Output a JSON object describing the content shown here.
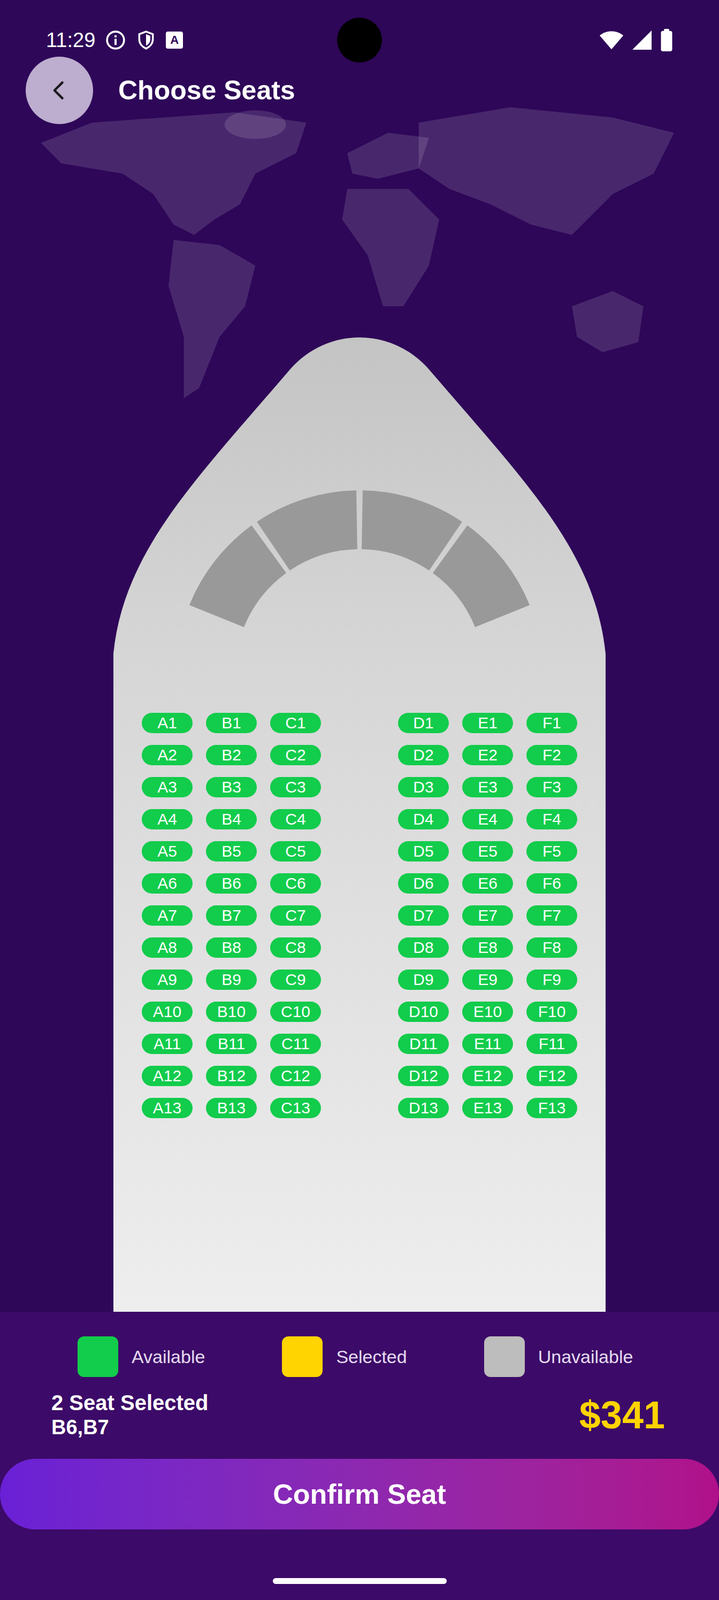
{
  "status_bar": {
    "time": "11:29",
    "keyboard_icon": "A"
  },
  "header": {
    "title": "Choose Seats"
  },
  "seat_rows": [
    {
      "left": [
        {
          "label": "A1",
          "selected": false,
          "available": true
        },
        {
          "label": "B1",
          "selected": false,
          "available": true
        },
        {
          "label": "C1",
          "selected": false,
          "available": true
        }
      ],
      "right": [
        {
          "label": "D1",
          "selected": false,
          "available": true
        },
        {
          "label": "E1",
          "selected": false,
          "available": true
        },
        {
          "label": "F1",
          "selected": false,
          "available": true
        }
      ]
    },
    {
      "left": [
        {
          "label": "A2",
          "selected": false,
          "available": true
        },
        {
          "label": "B2",
          "selected": false,
          "available": true
        },
        {
          "label": "C2",
          "selected": false,
          "available": true
        }
      ],
      "right": [
        {
          "label": "D2",
          "selected": false,
          "available": true
        },
        {
          "label": "E2",
          "selected": false,
          "available": true
        },
        {
          "label": "F2",
          "selected": false,
          "available": true
        }
      ]
    },
    {
      "left": [
        {
          "label": "A3",
          "selected": false,
          "available": true
        },
        {
          "label": "B3",
          "selected": false,
          "available": true
        },
        {
          "label": "C3",
          "selected": false,
          "available": true
        }
      ],
      "right": [
        {
          "label": "D3",
          "selected": false,
          "available": true
        },
        {
          "label": "E3",
          "selected": false,
          "available": true
        },
        {
          "label": "F3",
          "selected": false,
          "available": true
        }
      ]
    },
    {
      "left": [
        {
          "label": "A4",
          "selected": false,
          "available": true
        },
        {
          "label": "B4",
          "selected": false,
          "available": true
        },
        {
          "label": "C4",
          "selected": false,
          "available": true
        }
      ],
      "right": [
        {
          "label": "D4",
          "selected": false,
          "available": true
        },
        {
          "label": "E4",
          "selected": false,
          "available": true
        },
        {
          "label": "F4",
          "selected": false,
          "available": true
        }
      ]
    },
    {
      "left": [
        {
          "label": "A5",
          "selected": false,
          "available": true
        },
        {
          "label": "B5",
          "selected": false,
          "available": true
        },
        {
          "label": "C5",
          "selected": false,
          "available": true
        }
      ],
      "right": [
        {
          "label": "D5",
          "selected": false,
          "available": true
        },
        {
          "label": "E5",
          "selected": false,
          "available": true
        },
        {
          "label": "F5",
          "selected": false,
          "available": true
        }
      ]
    },
    {
      "left": [
        {
          "label": "A6",
          "selected": false,
          "available": true
        },
        {
          "label": "B6",
          "selected": false,
          "available": true
        },
        {
          "label": "C6",
          "selected": false,
          "available": true
        }
      ],
      "right": [
        {
          "label": "D6",
          "selected": false,
          "available": true
        },
        {
          "label": "E6",
          "selected": false,
          "available": true
        },
        {
          "label": "F6",
          "selected": false,
          "available": true
        }
      ]
    },
    {
      "left": [
        {
          "label": "A7",
          "selected": false,
          "available": true
        },
        {
          "label": "B7",
          "selected": false,
          "available": true
        },
        {
          "label": "C7",
          "selected": false,
          "available": true
        }
      ],
      "right": [
        {
          "label": "D7",
          "selected": false,
          "available": true
        },
        {
          "label": "E7",
          "selected": false,
          "available": true
        },
        {
          "label": "F7",
          "selected": false,
          "available": true
        }
      ]
    },
    {
      "left": [
        {
          "label": "A8",
          "selected": false,
          "available": true
        },
        {
          "label": "B8",
          "selected": false,
          "available": true
        },
        {
          "label": "C8",
          "selected": false,
          "available": true
        }
      ],
      "right": [
        {
          "label": "D8",
          "selected": false,
          "available": true
        },
        {
          "label": "E8",
          "selected": false,
          "available": true
        },
        {
          "label": "F8",
          "selected": false,
          "available": true
        }
      ]
    },
    {
      "left": [
        {
          "label": "A9",
          "selected": false,
          "available": true
        },
        {
          "label": "B9",
          "selected": false,
          "available": true
        },
        {
          "label": "C9",
          "selected": false,
          "available": true
        }
      ],
      "right": [
        {
          "label": "D9",
          "selected": false,
          "available": true
        },
        {
          "label": "E9",
          "selected": false,
          "available": true
        },
        {
          "label": "F9",
          "selected": false,
          "available": true
        }
      ]
    },
    {
      "left": [
        {
          "label": "A10",
          "selected": false,
          "available": true
        },
        {
          "label": "B10",
          "selected": false,
          "available": true
        },
        {
          "label": "C10",
          "selected": false,
          "available": true
        }
      ],
      "right": [
        {
          "label": "D10",
          "selected": false,
          "available": true
        },
        {
          "label": "E10",
          "selected": false,
          "available": true
        },
        {
          "label": "F10",
          "selected": false,
          "available": true
        }
      ]
    },
    {
      "left": [
        {
          "label": "A11",
          "selected": false,
          "available": true
        },
        {
          "label": "B11",
          "selected": false,
          "available": true
        },
        {
          "label": "C11",
          "selected": false,
          "available": true
        }
      ],
      "right": [
        {
          "label": "D11",
          "selected": false,
          "available": true
        },
        {
          "label": "E11",
          "selected": false,
          "available": true
        },
        {
          "label": "F11",
          "selected": false,
          "available": true
        }
      ]
    },
    {
      "left": [
        {
          "label": "A12",
          "selected": false,
          "available": true
        },
        {
          "label": "B12",
          "selected": false,
          "available": true
        },
        {
          "label": "C12",
          "selected": false,
          "available": true
        }
      ],
      "right": [
        {
          "label": "D12",
          "selected": false,
          "available": true
        },
        {
          "label": "E12",
          "selected": false,
          "available": true
        },
        {
          "label": "F12",
          "selected": false,
          "available": true
        }
      ]
    },
    {
      "left": [
        {
          "label": "A13",
          "selected": false,
          "available": true
        },
        {
          "label": "B13",
          "selected": false,
          "available": true
        },
        {
          "label": "C13",
          "selected": false,
          "available": true
        }
      ],
      "right": [
        {
          "label": "D13",
          "selected": false,
          "available": true
        },
        {
          "label": "E13",
          "selected": false,
          "available": true
        },
        {
          "label": "F13",
          "selected": false,
          "available": true
        }
      ]
    }
  ],
  "legend": [
    {
      "label": "Available",
      "color": "#12cc4b"
    },
    {
      "label": "Selected",
      "color": "#ffd400"
    },
    {
      "label": "Unavailable",
      "color": "#bdbdbd"
    }
  ],
  "summary": {
    "count": "2 Seat Selected",
    "seats": "B6,B7",
    "price": "$341"
  },
  "confirm_button": "Confirm Seat"
}
